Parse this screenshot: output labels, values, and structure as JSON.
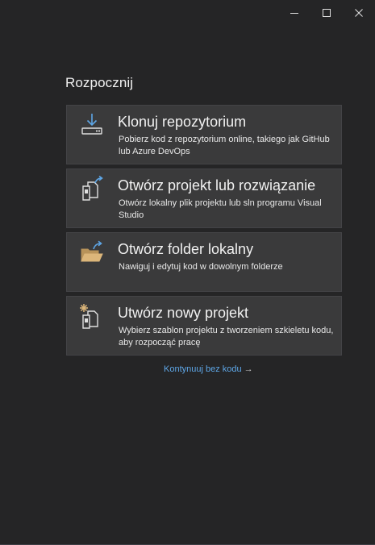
{
  "window": {
    "controls": [
      "minimize-icon",
      "maximize-icon",
      "close-icon"
    ]
  },
  "heading": "Rozpocznij",
  "cards": [
    {
      "icon": "clone-download-icon",
      "title": "Klonuj repozytorium",
      "description": "Pobierz kod z repozytorium online, takiego jak GitHub lub Azure DevOps"
    },
    {
      "icon": "open-project-icon",
      "title": "Otwórz projekt lub rozwiązanie",
      "description": "Otwórz lokalny plik projektu lub sln programu Visual Studio"
    },
    {
      "icon": "open-folder-icon",
      "title": "Otwórz folder lokalny",
      "description": "Nawiguj i edytuj kod w dowolnym folderze"
    },
    {
      "icon": "new-project-icon",
      "title": "Utwórz nowy projekt",
      "description": "Wybierz szablon projektu z tworzeniem szkieletu kodu, aby rozpocząć pracę"
    }
  ],
  "continue_link": {
    "label": "Kontynuuj bez kodu",
    "arrow": "→"
  },
  "colors": {
    "background": "#252526",
    "card": "#3a3a3b",
    "accent": "#0e70c0",
    "link": "#5ea6e6",
    "folder": "#dcb67a"
  }
}
